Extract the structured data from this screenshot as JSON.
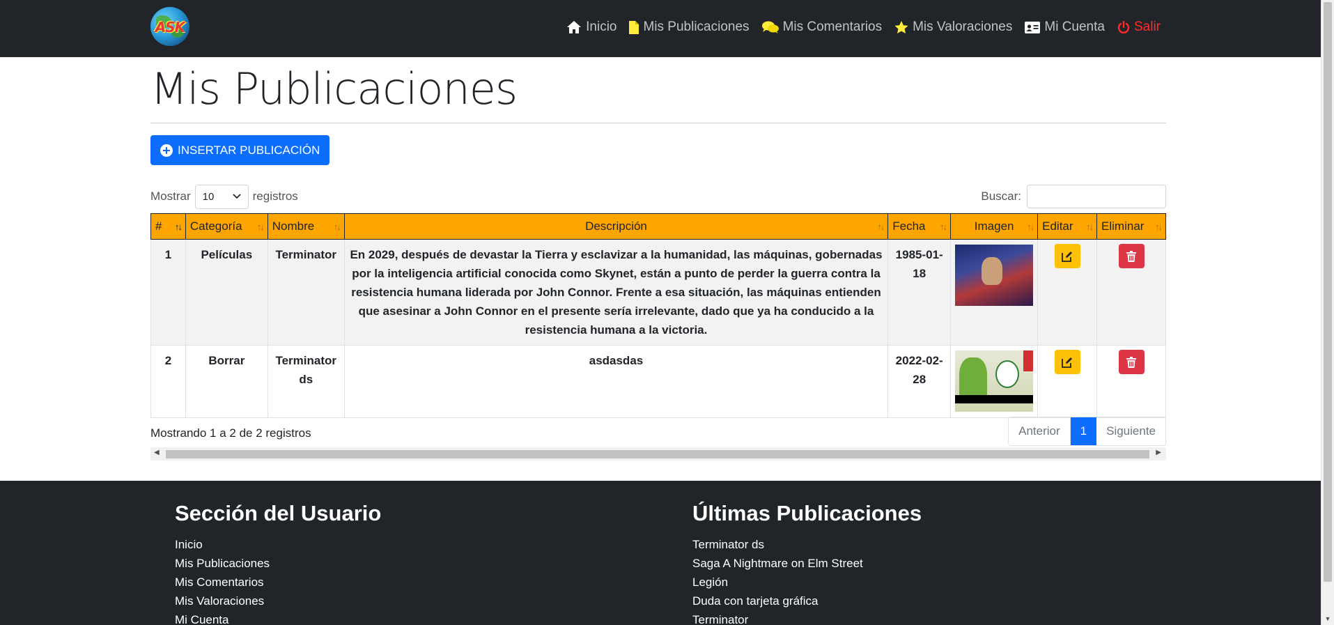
{
  "navbar": {
    "logo_text": "ASK",
    "items": [
      {
        "label": "Inicio",
        "icon": "home-icon"
      },
      {
        "label": "Mis Publicaciones",
        "icon": "file-icon"
      },
      {
        "label": "Mis Comentarios",
        "icon": "comments-icon"
      },
      {
        "label": "Mis Valoraciones",
        "icon": "star-icon"
      },
      {
        "label": "Mi Cuenta",
        "icon": "id-card-icon"
      },
      {
        "label": "Salir",
        "icon": "power-icon"
      }
    ]
  },
  "main": {
    "title": "Mis Publicaciones",
    "insert_button": "INSERTAR PUBLICACIÓN",
    "show_label": "Mostrar",
    "show_value": "10",
    "records_label": "registros",
    "search_label": "Buscar:",
    "search_value": ""
  },
  "table": {
    "columns": [
      "#",
      "Categoría",
      "Nombre",
      "Descripción",
      "Fecha",
      "Imagen",
      "Editar",
      "Eliminar"
    ],
    "rows": [
      {
        "id": "1",
        "category": "Películas",
        "name": "Terminator",
        "description": "En 2029, después de devastar la Tierra y esclavizar a la humanidad, las máquinas, gobernadas por la inteligencia artificial conocida como Skynet, están a punto de perder la guerra contra la resistencia humana liderada por John Connor. Frente a esa situación, las máquinas entienden que asesinar a John Connor en el presente sería irrelevante, dado que ya ha conducido a la resistencia humana a la victoria.",
        "date": "1985-01-18"
      },
      {
        "id": "2",
        "category": "Borrar",
        "name": "Terminator ds",
        "description": "asdasdas",
        "date": "2022-02-28"
      }
    ]
  },
  "pagination": {
    "info": "Mostrando 1 a 2 de 2 registros",
    "prev": "Anterior",
    "current": "1",
    "next": "Siguiente"
  },
  "footer": {
    "user_section": {
      "title": "Sección del Usuario",
      "links": [
        "Inicio",
        "Mis Publicaciones",
        "Mis Comentarios",
        "Mis Valoraciones",
        "Mi Cuenta"
      ]
    },
    "latest": {
      "title": "Últimas Publicaciones",
      "links": [
        "Terminator ds",
        "Saga A Nightmare on Elm Street",
        "Legión",
        "Duda con tarjeta gráfica",
        "Terminator"
      ]
    }
  },
  "colors": {
    "navbar": "#212529",
    "header_row": "#ffa500",
    "primary": "#0d6efd",
    "edit": "#ffc107",
    "delete": "#dc3545",
    "exit": "#ff2b2b"
  }
}
